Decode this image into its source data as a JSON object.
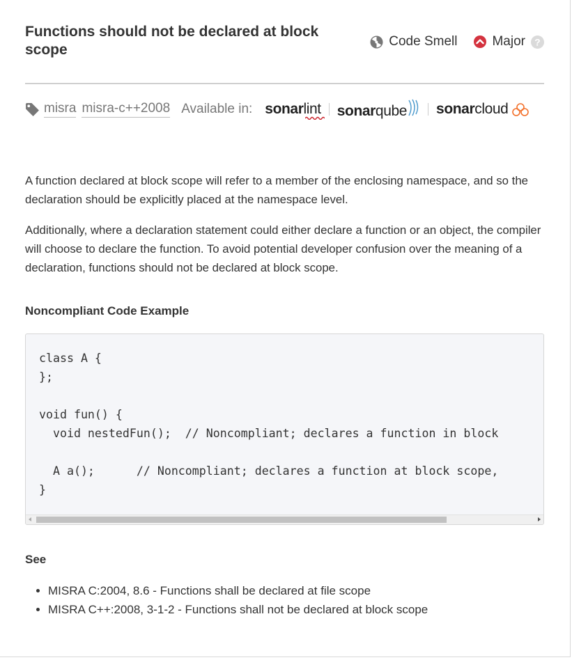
{
  "rule": {
    "title": "Functions should not be declared at block scope",
    "type_label": "Code Smell",
    "severity_label": "Major"
  },
  "tags": [
    "misra",
    "misra-c++2008"
  ],
  "available_in": {
    "label": "Available in:",
    "products": [
      {
        "bold": "sonar",
        "thin": "lint"
      },
      {
        "bold": "sonar",
        "thin": "qube"
      },
      {
        "bold": "sonar",
        "thin": "cloud"
      }
    ]
  },
  "description": [
    "A function declared at block scope will refer to a member of the enclosing namespace, and so the declaration should be explicitly placed at the namespace level.",
    "Additionally, where a declaration statement could either declare a function or an object, the compiler will choose to declare the function. To avoid potential developer confusion over the meaning of a declaration, functions should not be declared at block scope."
  ],
  "noncompliant": {
    "heading": "Noncompliant Code Example",
    "code": "class A {\n};\n\nvoid fun() {\n  void nestedFun();  // Noncompliant; declares a function in block\n\n  A a();      // Noncompliant; declares a function at block scope,\n}"
  },
  "see": {
    "heading": "See",
    "items": [
      "MISRA C:2004, 8.6 - Functions shall be declared at file scope",
      "MISRA C++:2008, 3-1-2 - Functions shall not be declared at block scope"
    ]
  },
  "colors": {
    "severity_major": "#d4333f",
    "sonarcloud_accent": "#f3702a",
    "sonarlint_squiggle": "#cb2029",
    "sonarqube_waves": "#4e9bcd"
  },
  "icons": {
    "type": "code-smell-icon",
    "severity": "major-severity-icon",
    "help": "help-icon",
    "tag": "tag-icon"
  }
}
